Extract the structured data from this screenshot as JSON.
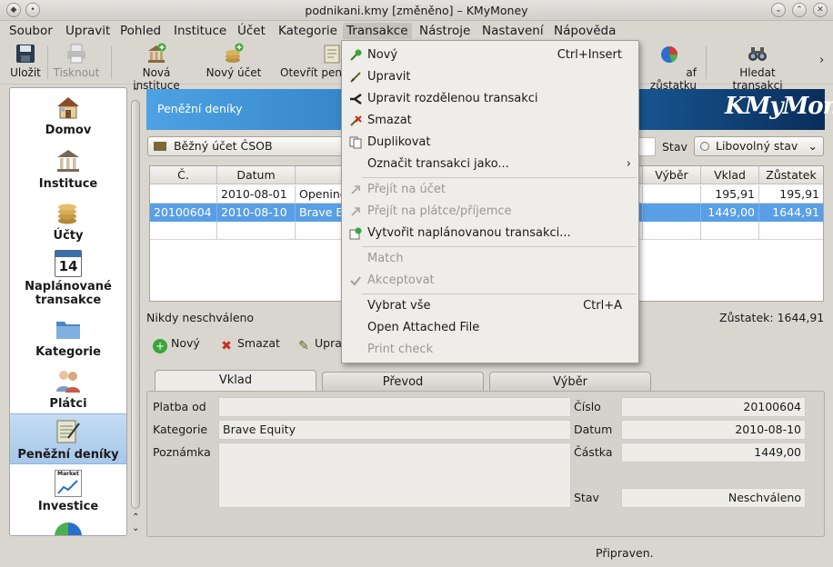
{
  "window": {
    "title": "podnikani.kmy [změněno] – KMyMoney"
  },
  "menubar": [
    "Soubor",
    "Upravit",
    "Pohled",
    "Instituce",
    "Účet",
    "Kategorie",
    "Transakce",
    "Nástroje",
    "Nastavení",
    "Nápověda"
  ],
  "toolbar": {
    "save": "Uložit",
    "print": "Tisknout",
    "new_institution": "Nová instituce",
    "new_account": "Nový účet",
    "open_ledger": "Otevřít pen",
    "balance_chart": "af zůstatku",
    "find": "Hledat transakci",
    "more": "›"
  },
  "sidebar": [
    {
      "label": "Domov",
      "icon": "home-icon"
    },
    {
      "label": "Instituce",
      "icon": "institution-icon"
    },
    {
      "label": "Účty",
      "icon": "accounts-icon"
    },
    {
      "label": "Naplánované transakce",
      "icon": "calendar-icon",
      "day": "14"
    },
    {
      "label": "Kategorie",
      "icon": "categories-icon"
    },
    {
      "label": "Plátci",
      "icon": "payees-icon"
    },
    {
      "label": "Peněžní deníky",
      "icon": "ledger-icon"
    },
    {
      "label": "Investice",
      "icon": "investments-icon",
      "badge": "Market"
    }
  ],
  "main": {
    "banner_title": "Peněžní deníky",
    "logo": "KMyMoney",
    "account_combo": "Běžný účet ČSOB",
    "status_label": "Stav",
    "status_filter": "Libovolný stav",
    "columns": [
      "Č.",
      "Datum",
      "",
      "Výběr",
      "Vklad",
      "Zůstatek"
    ],
    "rows": [
      {
        "num": "",
        "date": "2010-08-01",
        "desc": "Opening",
        "withdrawal": "",
        "deposit": "195,91",
        "balance": "195,91"
      },
      {
        "num": "20100604",
        "date": "2010-08-10",
        "desc": "Brave Eq",
        "withdrawal": "",
        "deposit": "1449,00",
        "balance": "1644,91"
      }
    ],
    "reconcile": "Nikdy neschváleno",
    "balance": "Zůstatek: 1644,91",
    "actions": {
      "new": "Nový",
      "delete": "Smazat",
      "edit": "Upra"
    }
  },
  "form": {
    "tabs": [
      "Vklad",
      "Převod",
      "Výběr"
    ],
    "labels": {
      "payee": "Platba od",
      "category": "Kategorie",
      "memo": "Poznámka",
      "number": "Číslo",
      "date": "Datum",
      "amount": "Částka",
      "status": "Stav"
    },
    "values": {
      "payee": "",
      "category": "Brave Equity",
      "memo": "",
      "number": "20100604",
      "date": "2010-08-10",
      "amount": "1449,00",
      "status": "Neschváleno"
    }
  },
  "statusbar": "Připraven.",
  "dropdown": {
    "items": [
      {
        "label": "Nový",
        "shortcut": "Ctrl+Insert",
        "icon": "new-icon",
        "disabled": false
      },
      {
        "label": "Upravit",
        "shortcut": "",
        "icon": "edit-icon",
        "disabled": false
      },
      {
        "label": "Upravit rozdělenou transakci",
        "shortcut": "",
        "icon": "split-icon",
        "disabled": false
      },
      {
        "label": "Smazat",
        "shortcut": "",
        "icon": "delete-icon",
        "disabled": false
      },
      {
        "label": "Duplikovat",
        "shortcut": "",
        "icon": "duplicate-icon",
        "disabled": false
      },
      {
        "label": "Označit transakci jako...",
        "shortcut": "›",
        "icon": "",
        "disabled": false
      },
      {
        "label": "Přejít na účet",
        "shortcut": "",
        "icon": "goto-icon",
        "disabled": true
      },
      {
        "label": "Přejít na plátce/příjemce",
        "shortcut": "",
        "icon": "goto-icon",
        "disabled": true
      },
      {
        "label": "Vytvořit naplánovanou transakci...",
        "shortcut": "",
        "icon": "schedule-icon",
        "disabled": false
      },
      {
        "label": "Match",
        "shortcut": "",
        "icon": "",
        "disabled": true
      },
      {
        "label": "Akceptovat",
        "shortcut": "",
        "icon": "check-icon",
        "disabled": true
      },
      {
        "label": "Vybrat vše",
        "shortcut": "Ctrl+A",
        "icon": "",
        "disabled": false
      },
      {
        "label": "Open Attached File",
        "shortcut": "",
        "icon": "",
        "disabled": false
      },
      {
        "label": "Print check",
        "shortcut": "",
        "icon": "",
        "disabled": true
      }
    ]
  }
}
